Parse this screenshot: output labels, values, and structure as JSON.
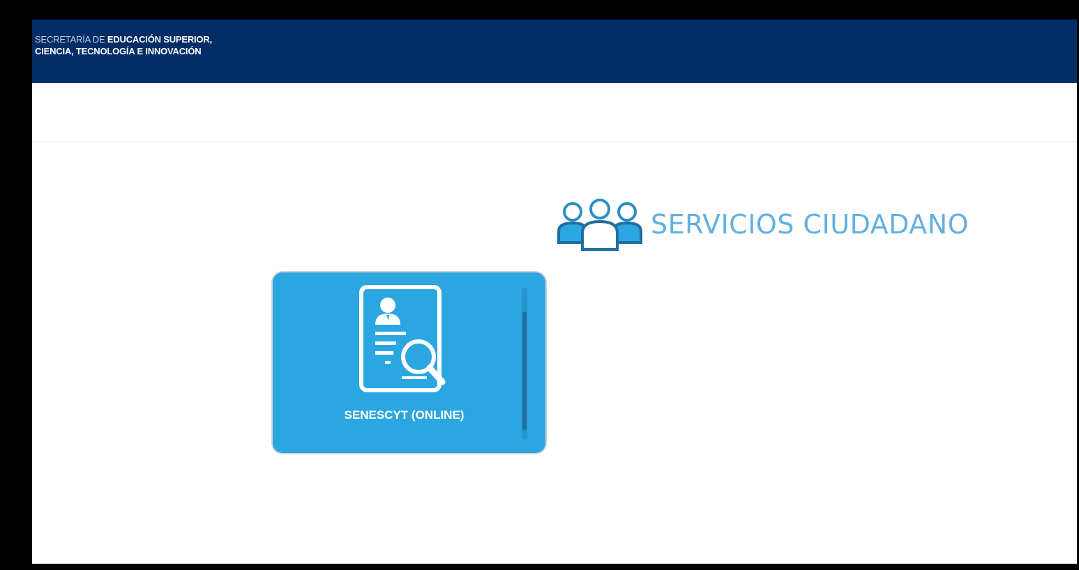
{
  "header": {
    "brand_line1_light": "SECRETARÍA DE",
    "brand_line1_bold": "EDUCACIÓN SUPERIOR,",
    "brand_line2": "CIENCIA, TECNOLOGÍA E INNOVACIÓN",
    "background_color": "#022d67"
  },
  "section": {
    "title": "SERVICIOS CIUDADANO",
    "icon": "people-group-icon",
    "accent_color": "#63b0e0"
  },
  "services": [
    {
      "label": "SENESCYT (ONLINE)",
      "icon": "document-search-icon",
      "color": "#2ca6e0"
    }
  ]
}
